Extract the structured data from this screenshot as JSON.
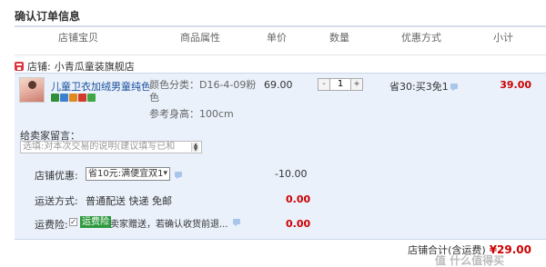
{
  "page_title": "确认订单信息",
  "columns": [
    "店铺宝贝",
    "商品属性",
    "单价",
    "数量",
    "优惠方式",
    "小计"
  ],
  "shop": {
    "prefix": "店铺:",
    "name": "小青瓜童装旗舰店"
  },
  "item": {
    "title": "儿童卫衣加绒男童纯色...",
    "sku_color": "颜色分类：D16-4-09粉色",
    "sku_height": "参考身高：100cm",
    "price": "69.00",
    "quantity": "1",
    "qty_minus": "-",
    "qty_plus": "+",
    "promo": "省30:买3免1",
    "subtotal": "39.00",
    "badge_colors": [
      "#2f8f3a",
      "#3d7fd0",
      "#e08a1e",
      "#d33a2c",
      "#3fa845"
    ]
  },
  "message": {
    "label": "给卖家留言：",
    "placeholder": "选填:对本次交易的说明(建议填写已和"
  },
  "shop_discount": {
    "label": "店铺优惠:",
    "selected": "省10元:满便宜双1",
    "value": "-10.00"
  },
  "shipping": {
    "label": "运送方式:",
    "text": "普通配送 快递 免邮",
    "value": "0.00"
  },
  "insurance": {
    "label": "运费险:",
    "checkbox_mark": "✓",
    "badge": "运费险",
    "desc": "卖家赠送，若确认收货前退...",
    "value": "0.00"
  },
  "total": {
    "label": "店铺合计(含运费)",
    "value": "¥29.00"
  },
  "watermark": "值 什么值得买"
}
